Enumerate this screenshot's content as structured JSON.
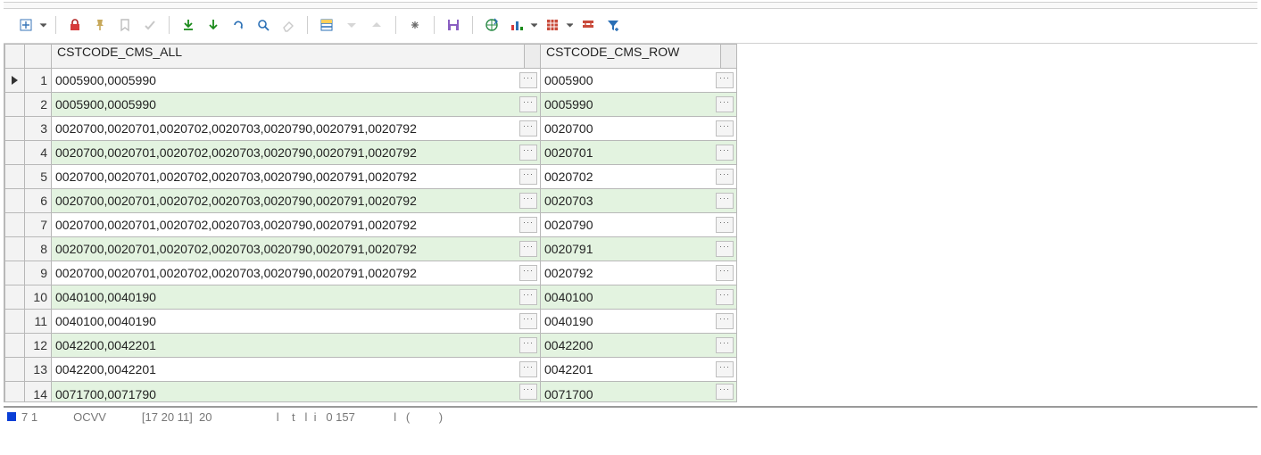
{
  "toolbar": {
    "icons": [
      "fit-window",
      "dropdown",
      "sep",
      "lock",
      "pin",
      "bookmark",
      "check",
      "sep",
      "fetch-all",
      "fetch-page",
      "refresh",
      "find",
      "eraser",
      "sep",
      "single-record",
      "down",
      "up",
      "sep",
      "link",
      "sep",
      "save",
      "sep",
      "export",
      "chart",
      "dropdown",
      "grid-options",
      "dropdown",
      "query-builder",
      "filter"
    ]
  },
  "columns": [
    "CSTCODE_CMS_ALL",
    "CSTCODE_CMS_ROW"
  ],
  "rows": [
    {
      "n": 1,
      "all": "0005900,0005990",
      "row": "0005900",
      "current": true
    },
    {
      "n": 2,
      "all": "0005900,0005990",
      "row": "0005990"
    },
    {
      "n": 3,
      "all": "0020700,0020701,0020702,0020703,0020790,0020791,0020792",
      "row": "0020700"
    },
    {
      "n": 4,
      "all": "0020700,0020701,0020702,0020703,0020790,0020791,0020792",
      "row": "0020701"
    },
    {
      "n": 5,
      "all": "0020700,0020701,0020702,0020703,0020790,0020791,0020792",
      "row": "0020702"
    },
    {
      "n": 6,
      "all": "0020700,0020701,0020702,0020703,0020790,0020791,0020792",
      "row": "0020703"
    },
    {
      "n": 7,
      "all": "0020700,0020701,0020702,0020703,0020790,0020791,0020792",
      "row": "0020790"
    },
    {
      "n": 8,
      "all": "0020700,0020701,0020702,0020703,0020790,0020791,0020792",
      "row": "0020791"
    },
    {
      "n": 9,
      "all": "0020700,0020701,0020702,0020703,0020790,0020791,0020792",
      "row": "0020792"
    },
    {
      "n": 10,
      "all": "0040100,0040190",
      "row": "0040100"
    },
    {
      "n": 11,
      "all": "0040100,0040190",
      "row": "0040190"
    },
    {
      "n": 12,
      "all": "0042200,0042201",
      "row": "0042200"
    },
    {
      "n": 13,
      "all": "0042200,0042201",
      "row": "0042201"
    },
    {
      "n": 14,
      "all": "0071700,0071790",
      "row": "0071700",
      "clipped": true
    }
  ],
  "ellipsis_label": "···",
  "status": {
    "frag1": "7 1",
    "frag2": "OCVV",
    "frag3": "[17 20 11]  20                    l    t   l  i   0 157            l   (         )"
  }
}
